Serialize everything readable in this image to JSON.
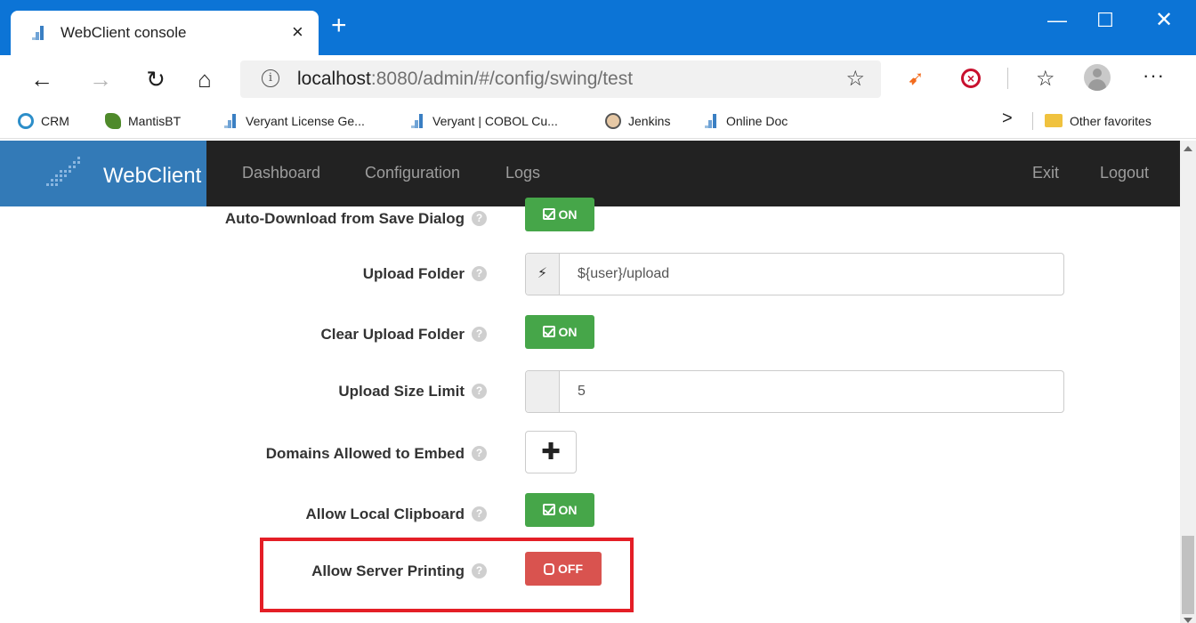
{
  "browser": {
    "tab_title": "WebClient console",
    "tab_close": "×",
    "new_tab": "+",
    "window_controls": {
      "minimize": "—",
      "maximize": "☐",
      "close": "✕"
    },
    "nav": {
      "back": "←",
      "forward": "→",
      "reload": "↻",
      "home": "⌂"
    },
    "url_host": "localhost",
    "url_rest": ":8080/admin/#/config/swing/test",
    "favorite_star": "☆",
    "more": "···",
    "favorites": [
      {
        "label": "CRM",
        "icon": "crm-globe-icon"
      },
      {
        "label": "MantisBT",
        "icon": "mantis-icon"
      },
      {
        "label": "Veryant License Ge...",
        "icon": "veryant-icon"
      },
      {
        "label": "Veryant | COBOL Cu...",
        "icon": "veryant-icon"
      },
      {
        "label": "Jenkins",
        "icon": "jenkins-icon"
      },
      {
        "label": "Online Doc",
        "icon": "veryant-icon"
      }
    ],
    "fav_overflow": ">",
    "other_favorites": "Other favorites"
  },
  "app": {
    "brand": "WebClient",
    "nav_links": [
      "Dashboard",
      "Configuration",
      "Logs"
    ],
    "right_links": [
      "Exit",
      "Logout"
    ]
  },
  "form": {
    "auto_download": {
      "label": "Auto-Download from Save Dialog",
      "state": "ON"
    },
    "upload_folder": {
      "label": "Upload Folder",
      "value": "${user}/upload",
      "addon_icon": "⚡"
    },
    "clear_upload_folder": {
      "label": "Clear Upload Folder",
      "state": "ON"
    },
    "upload_size_limit": {
      "label": "Upload Size Limit",
      "value": "5"
    },
    "domains_allowed": {
      "label": "Domains Allowed to Embed",
      "add": "✚"
    },
    "allow_local_clipboard": {
      "label": "Allow Local Clipboard",
      "state": "ON"
    },
    "allow_server_printing": {
      "label": "Allow Server Printing",
      "state": "OFF"
    },
    "help_glyph": "?"
  },
  "colors": {
    "title_bar": "#0c74d6",
    "brand_bg": "#337ab7",
    "navbar_bg": "#222222",
    "on_green": "#46a649",
    "off_red": "#d9534f",
    "highlight_red": "#e41e26"
  }
}
